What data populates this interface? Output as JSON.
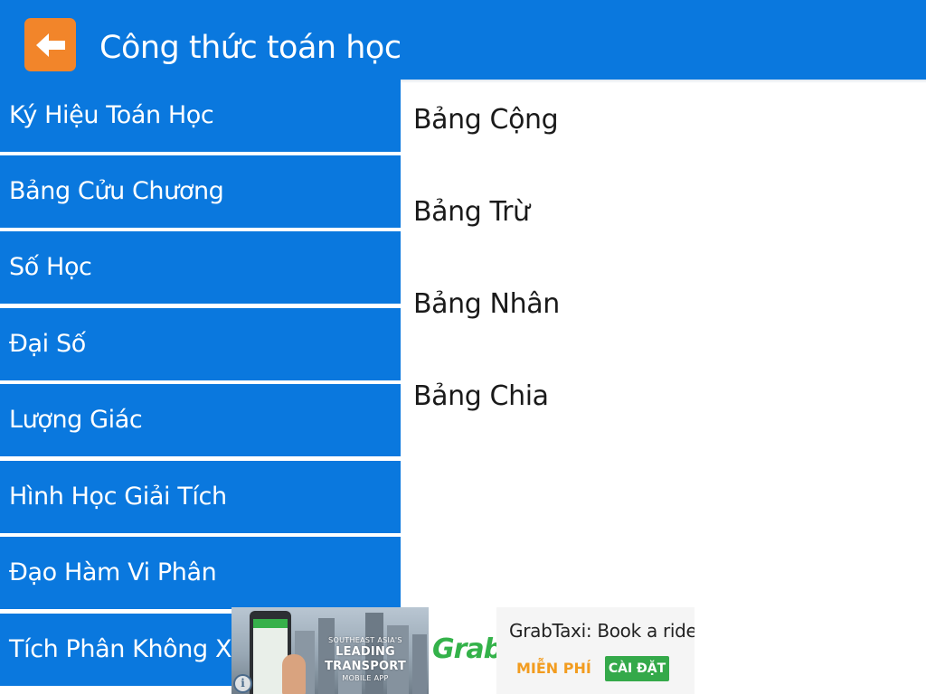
{
  "header": {
    "title": "Công thức toán học",
    "back_icon": "arrow-left-icon",
    "back_button_color": "#f2852a",
    "bar_color": "#0a78de"
  },
  "menu": {
    "items": [
      {
        "label": "Ký Hiệu Toán Học"
      },
      {
        "label": "Bảng Cửu Chương"
      },
      {
        "label": "Số Học"
      },
      {
        "label": "Đại Số"
      },
      {
        "label": "Lượng Giác"
      },
      {
        "label": "Hình Học Giải Tích"
      },
      {
        "label": "Đạo Hàm Vi Phân"
      },
      {
        "label": "Tích Phân Không Xác"
      }
    ]
  },
  "content": {
    "items": [
      {
        "label": "Bảng Cộng"
      },
      {
        "label": "Bảng Trừ"
      },
      {
        "label": "Bảng Nhân"
      },
      {
        "label": "Bảng Chia"
      }
    ]
  },
  "ad": {
    "tagline_small_1": "SOUTHEAST ASIA'S",
    "tagline_big": "LEADING TRANSPORT",
    "tagline_small_2": "MOBILE APP",
    "logo": "Grab",
    "title": "GrabTaxi: Book a ride",
    "price": "MIỄN PHÍ",
    "install_label": "CÀI ĐẶT",
    "info_icon": "info-icon",
    "accent": "#34b24a",
    "price_color": "#f29c1f"
  }
}
